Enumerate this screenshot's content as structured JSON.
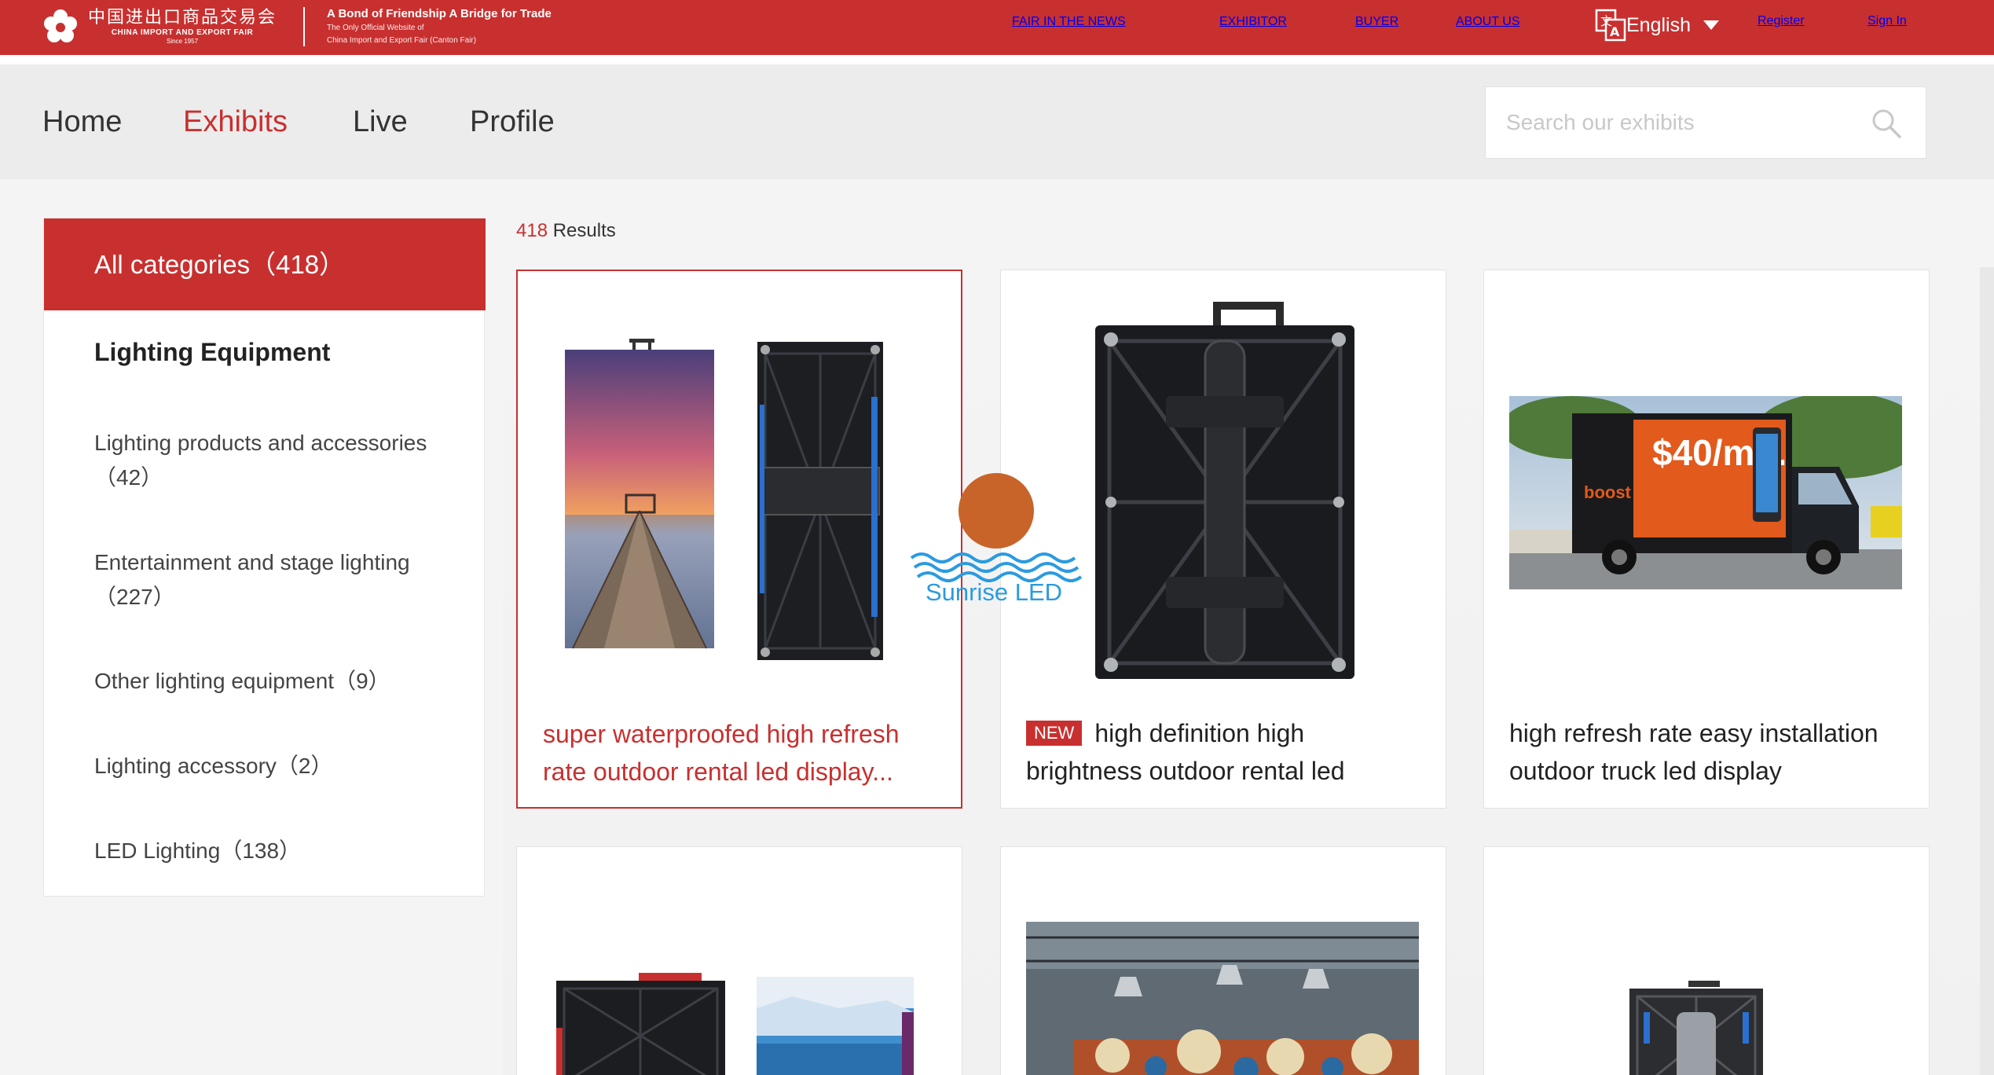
{
  "header": {
    "logo_cn": "中国进出口商品交易会",
    "logo_en": "CHINA IMPORT AND EXPORT FAIR",
    "logo_since": "Since 1957",
    "tagline": "A Bond of Friendship A Bridge for Trade",
    "tagline_sub1": "The Only Official Website of",
    "tagline_sub2": "China Import and Export Fair (Canton Fair)",
    "nav": {
      "news": "FAIR IN THE NEWS",
      "exhibitor": "EXHIBITOR",
      "buyer": "BUYER",
      "about": "ABOUT US",
      "language": "English",
      "register": "Register",
      "signin": "Sign In"
    }
  },
  "subnav": {
    "home": "Home",
    "exhibits": "Exhibits",
    "live": "Live",
    "profile": "Profile",
    "search_placeholder": "Search our exhibits"
  },
  "sidebar": {
    "all_label": "All categories（418）",
    "heading": "Lighting Equipment",
    "items": [
      {
        "label": "Lighting products and accessories（42）"
      },
      {
        "label": "Entertainment and stage lighting （227）"
      },
      {
        "label": "Other lighting equipment（9）"
      },
      {
        "label": "Lighting accessory（2）"
      },
      {
        "label": "LED Lighting（138）"
      }
    ]
  },
  "results": {
    "count": "418",
    "label": " Results"
  },
  "products": [
    {
      "title": "super waterproofed high refresh rate outdoor rental led display..."
    },
    {
      "badge": "NEW",
      "title": "high definition high brightness outdoor rental led video..."
    },
    {
      "title": "high refresh rate easy installation outdoor truck led display"
    }
  ],
  "watermark": {
    "brand": "Sunrise LED"
  },
  "truck_ad": {
    "brand": "boost mobile",
    "price": "$40/mo."
  },
  "colors": {
    "brand_red": "#c8302f",
    "sun_orange": "#c8642a",
    "wave_blue": "#2b9be0"
  }
}
